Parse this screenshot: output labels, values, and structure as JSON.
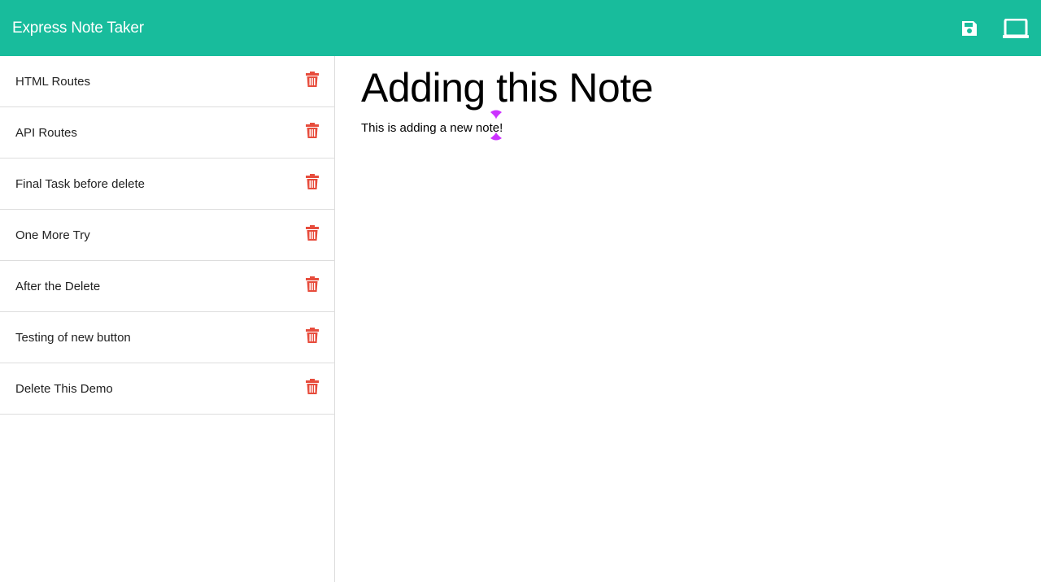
{
  "navbar": {
    "brand": "Express Note Taker",
    "icons": [
      "save-icon",
      "new-note-icon"
    ],
    "color": "#18bc9c"
  },
  "sidebar": {
    "notes": [
      {
        "title": "HTML Routes"
      },
      {
        "title": "API Routes"
      },
      {
        "title": "Final Task before delete"
      },
      {
        "title": "One More Try"
      },
      {
        "title": "After the Delete"
      },
      {
        "title": "Testing of new button"
      },
      {
        "title": "Delete This Demo"
      }
    ],
    "delete_icon": "trash-icon",
    "delete_color": "#e74c3c"
  },
  "main": {
    "note_title": "Adding this Note",
    "note_text": "This is adding a new note!"
  }
}
